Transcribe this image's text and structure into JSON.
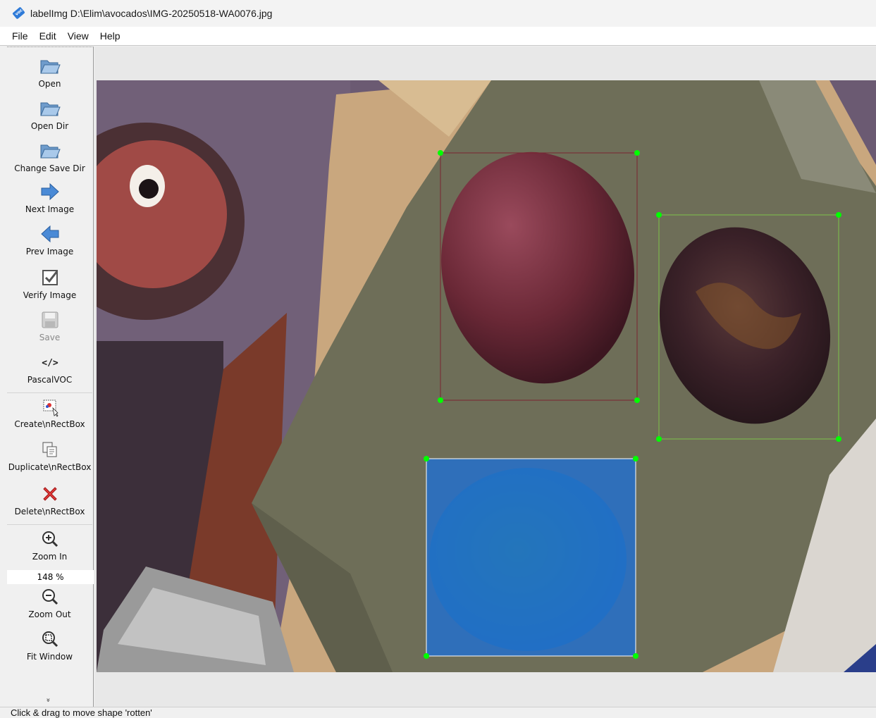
{
  "window": {
    "title": "labelImg D:\\Elim\\avocados\\IMG-20250518-WA0076.jpg",
    "app_icon": "labelimg-tag-icon",
    "app_icon_text": "voc"
  },
  "menu": {
    "items": [
      "File",
      "Edit",
      "View",
      "Help"
    ]
  },
  "toolbar": {
    "open": "Open",
    "open_dir": "Open Dir",
    "change_save_dir": "Change Save Dir",
    "next_image": "Next Image",
    "prev_image": "Prev Image",
    "verify_image": "Verify Image",
    "save": "Save",
    "format": "PascalVOC",
    "create_rect": "Create\\nRectBox",
    "duplicate_rect": "Duplicate\\nRectBox",
    "delete_rect": "Delete\\nRectBox",
    "zoom_in": "Zoom In",
    "zoom_level": "148 %",
    "zoom_out": "Zoom Out",
    "fit_window": "Fit Window",
    "more": "»"
  },
  "annotations": [
    {
      "state": "unselected",
      "color": "#7a2430"
    },
    {
      "state": "unselected",
      "color": "#7fc24a"
    },
    {
      "state": "selected",
      "color": "#1e6fd6"
    }
  ],
  "colors": {
    "handle": "#00ff00",
    "selected_fill": "#1e6fd6"
  },
  "status": {
    "text": "Click & drag to move shape 'rotten'"
  }
}
